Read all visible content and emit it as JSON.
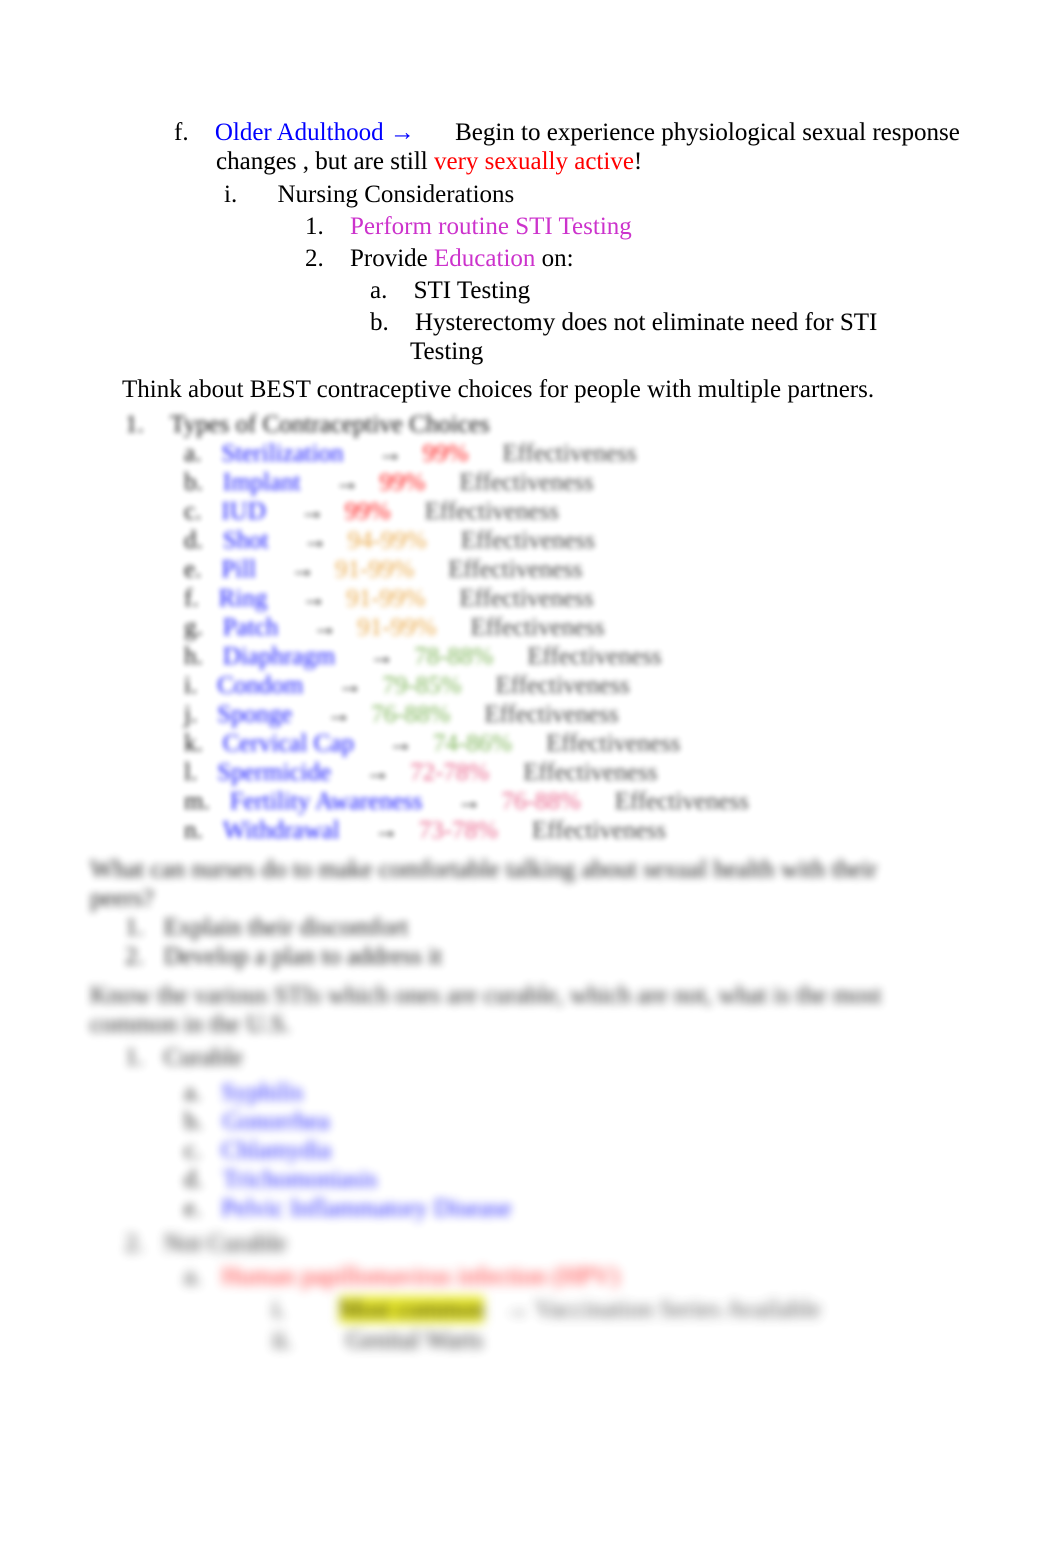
{
  "document": {
    "type": "study-notes",
    "page_background": "#ffffff"
  },
  "colors": {
    "blue": "#0000FF",
    "red": "#FF0000",
    "magenta": "#CC33CC",
    "black": "#000000",
    "green": "#70AD47",
    "orange": "#E8A33D",
    "pink": "#E75480",
    "highlight_yellow": "#E8E800"
  },
  "section_older_adulthood": {
    "marker": "f.",
    "title": "Older Adulthood",
    "arrow": "→",
    "body_before": "Begin to experience physiological sexual response changes , but are still ",
    "emphasis": "very sexually active",
    "body_after": "!",
    "nursing": {
      "marker": "i.",
      "label": "Nursing Considerations",
      "items": [
        {
          "marker": "1.",
          "text": "Perform routine STI Testing",
          "color": "magenta"
        },
        {
          "marker": "2.",
          "prefix": "Provide ",
          "highlight": "Education",
          "suffix": " on:",
          "subitems": [
            {
              "marker": "a.",
              "text": "STI Testing"
            },
            {
              "marker": "b.",
              "text": "Hysterectomy  does not eliminate need  for STI Testing"
            }
          ]
        }
      ]
    }
  },
  "prompt_contraceptive": {
    "text": "Think about BEST contraceptive choices for people with multiple partners."
  },
  "contraceptive_list": {
    "heading_marker": "1.",
    "heading": "Types of Contraceptive Choices",
    "rows": [
      {
        "marker": "a.",
        "name": "Sterilization",
        "arrow": "→",
        "percent": "99%",
        "note": "Effectiveness"
      },
      {
        "marker": "b.",
        "name": "Implant",
        "arrow": "→",
        "percent": "99%",
        "note": "Effectiveness"
      },
      {
        "marker": "c.",
        "name": "IUD",
        "arrow": "→",
        "percent": "99%",
        "note": "Effectiveness"
      },
      {
        "marker": "d.",
        "name": "Shot",
        "arrow": "→",
        "percent": "94-99%",
        "note": "Effectiveness"
      },
      {
        "marker": "e.",
        "name": "Pill",
        "arrow": "→",
        "percent": "91-99%",
        "note": "Effectiveness"
      },
      {
        "marker": "f.",
        "name": "Ring",
        "arrow": "→",
        "percent": "91-99%",
        "note": "Effectiveness"
      },
      {
        "marker": "g.",
        "name": "Patch",
        "arrow": "→",
        "percent": "91-99%",
        "note": "Effectiveness"
      },
      {
        "marker": "h.",
        "name": "Diaphragm",
        "arrow": "→",
        "percent": "78-88%",
        "note": "Effectiveness"
      },
      {
        "marker": "i.",
        "name": "Condom",
        "arrow": "→",
        "percent": "79-85%",
        "note": "Effectiveness"
      },
      {
        "marker": "j.",
        "name": "Sponge",
        "arrow": "→",
        "percent": "76-88%",
        "note": "Effectiveness"
      },
      {
        "marker": "k.",
        "name": "Cervical Cap",
        "arrow": "→",
        "percent": "74-86%",
        "note": "Effectiveness"
      },
      {
        "marker": "l.",
        "name": "Spermicide",
        "arrow": "→",
        "percent": "72-78%",
        "note": "Effectiveness"
      },
      {
        "marker": "m.",
        "name": "Fertility Awareness",
        "arrow": "→",
        "percent": "76-88%",
        "note": "Effectiveness"
      },
      {
        "marker": "n.",
        "name": "Withdrawal",
        "arrow": "→",
        "percent": "73-78%",
        "note": "Effectiveness"
      }
    ]
  },
  "prompt_comfort": {
    "text": "What can nurses do to make comfortable talking about sexual health with their peers?",
    "items": [
      {
        "marker": "1.",
        "text": "Explain their discomfort"
      },
      {
        "marker": "2.",
        "text": "Develop a plan to address it"
      }
    ]
  },
  "prompt_sti": {
    "text": "Know the various STIs which ones are curable, which are not, what is the most common in the U.S.",
    "groups": [
      {
        "marker": "1.",
        "label": "Curable",
        "items": [
          {
            "marker": "a.",
            "text": "Syphilis"
          },
          {
            "marker": "b.",
            "text": "Gonorrhea"
          },
          {
            "marker": "c.",
            "text": "Chlamydia"
          },
          {
            "marker": "d.",
            "text": "Trichomoniasis"
          },
          {
            "marker": "e.",
            "text": "Pelvic Inflammatory Disease"
          }
        ]
      },
      {
        "marker": "2.",
        "label": "Not Curable",
        "items": [
          {
            "marker": "a.",
            "text": "Human papillomavirus infection (HPV)",
            "color": "red",
            "subitems": [
              {
                "marker": "i.",
                "text": "Most common",
                "highlighted": true,
                "suffix": "→  Vaccination Series Available"
              },
              {
                "marker": "ii.",
                "text": "Genital Warts"
              }
            ]
          }
        ]
      }
    ]
  }
}
